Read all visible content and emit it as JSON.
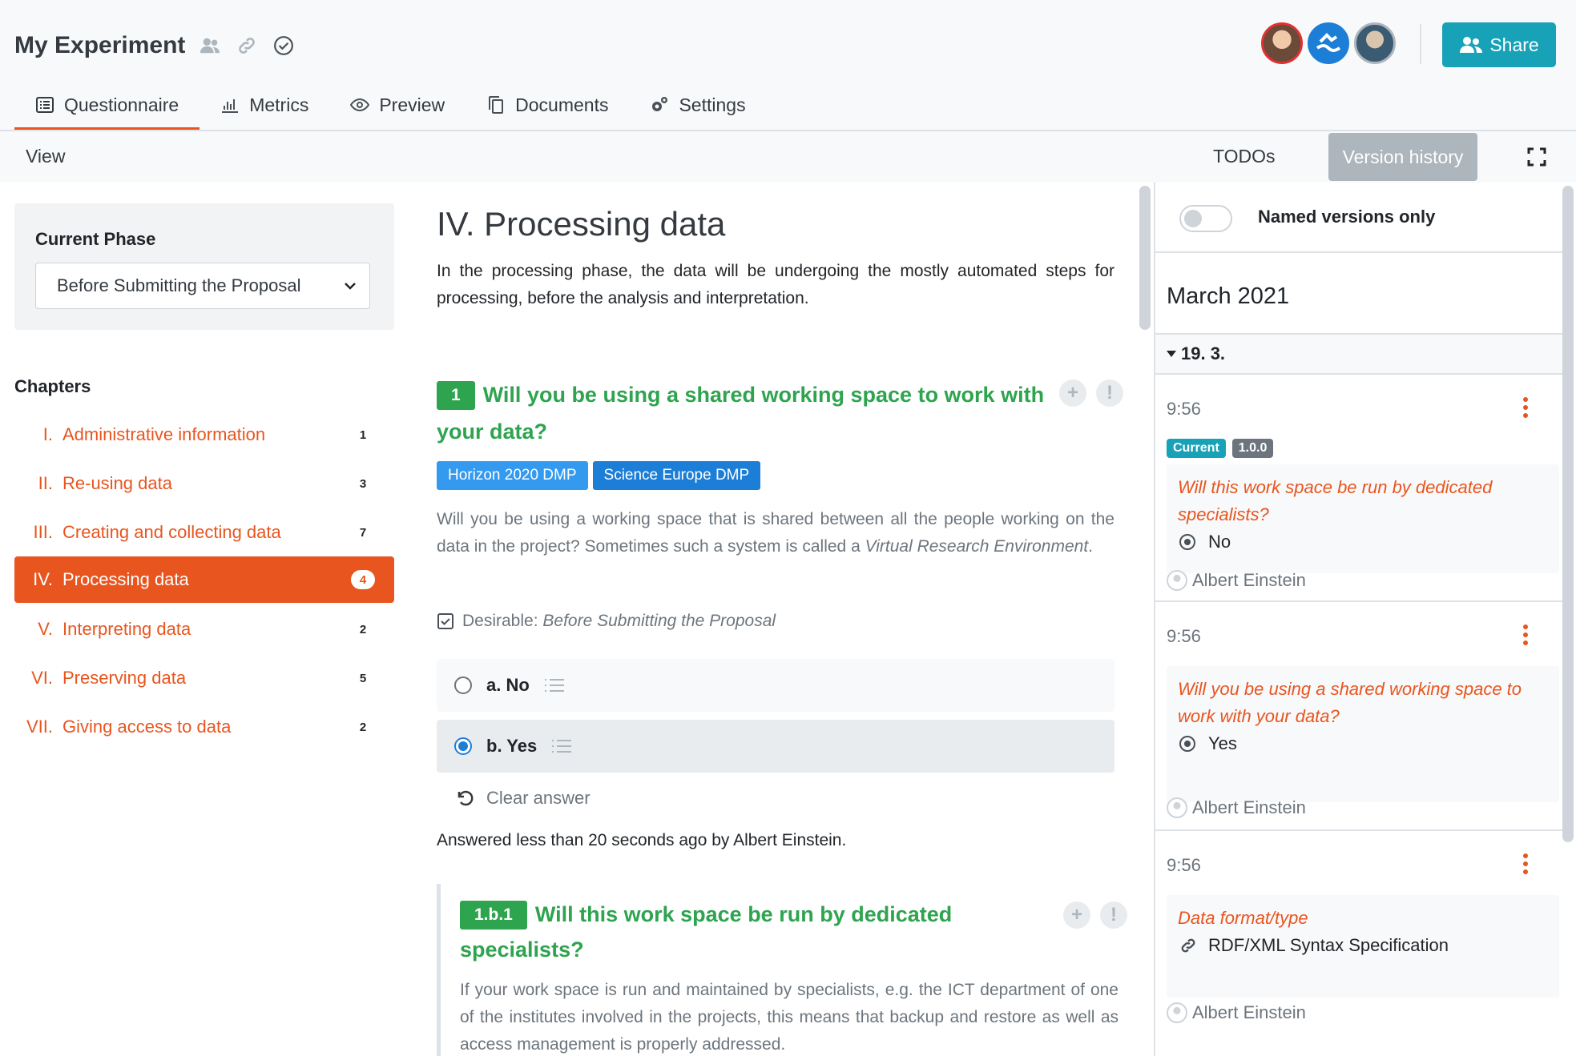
{
  "header": {
    "title": "My Experiment",
    "share_label": "Share",
    "tabs": [
      {
        "label": "Questionnaire",
        "icon": "list-icon"
      },
      {
        "label": "Metrics",
        "icon": "chart-icon"
      },
      {
        "label": "Preview",
        "icon": "eye-icon"
      },
      {
        "label": "Documents",
        "icon": "copy-icon"
      },
      {
        "label": "Settings",
        "icon": "gears-icon"
      }
    ]
  },
  "toolbar": {
    "view_label": "View",
    "todos_label": "TODOs",
    "version_history_label": "Version history"
  },
  "sidebar": {
    "phase_label": "Current Phase",
    "phase_value": "Before Submitting the Proposal",
    "chapters_label": "Chapters",
    "chapters": [
      {
        "num": "I.",
        "name": "Administrative information",
        "count": "1"
      },
      {
        "num": "II.",
        "name": "Re-using data",
        "count": "3"
      },
      {
        "num": "III.",
        "name": "Creating and collecting data",
        "count": "7"
      },
      {
        "num": "IV.",
        "name": "Processing data",
        "count": "4"
      },
      {
        "num": "V.",
        "name": "Interpreting data",
        "count": "2"
      },
      {
        "num": "VI.",
        "name": "Preserving data",
        "count": "5"
      },
      {
        "num": "VII.",
        "name": "Giving access to data",
        "count": "2"
      }
    ]
  },
  "main": {
    "chapter_title": "IV. Processing data",
    "chapter_desc": "In the processing phase, the data will be undergoing the mostly automated steps for processing, before the analysis and interpretation.",
    "question": {
      "num": "1",
      "title": "Will you be using a shared working space to work with your data?",
      "tags": [
        "Horizon 2020 DMP",
        "Science Europe DMP"
      ],
      "desc_plain": "Will you be using a working space that is shared between all the people working on the data in the project? Sometimes such a system is called a ",
      "desc_italic": "Virtual Research Environment",
      "desc_end": ".",
      "desirable_label": "Desirable:",
      "desirable_value": "Before Submitting the Proposal",
      "answers": [
        "a. No",
        "b. Yes"
      ],
      "clear_label": "Clear answer",
      "answered_text": "Answered less than 20 seconds ago by Albert Einstein."
    },
    "followup": {
      "num": "1.b.1",
      "title": "Will this work space be run by dedicated specialists?",
      "desc": "If your work space is run and maintained by specialists, e.g. the ICT department of one of the institutes involved in the projects, this means that backup and restore as well as access management is properly addressed."
    }
  },
  "history": {
    "toggle_label": "Named versions only",
    "month": "March 2021",
    "day": "19. 3.",
    "events": [
      {
        "time": "9:56",
        "badge_current": "Current",
        "badge_version": "1.0.0",
        "question": "Will this work space be run by dedicated specialists?",
        "answer": "No",
        "user": "Albert Einstein"
      },
      {
        "time": "9:56",
        "question": "Will you be using a shared working space to work with your data?",
        "answer": "Yes",
        "user": "Albert Einstein"
      },
      {
        "time": "9:56",
        "question": "Data format/type",
        "answer": "RDF/XML Syntax Specification",
        "user": "Albert Einstein"
      }
    ]
  }
}
